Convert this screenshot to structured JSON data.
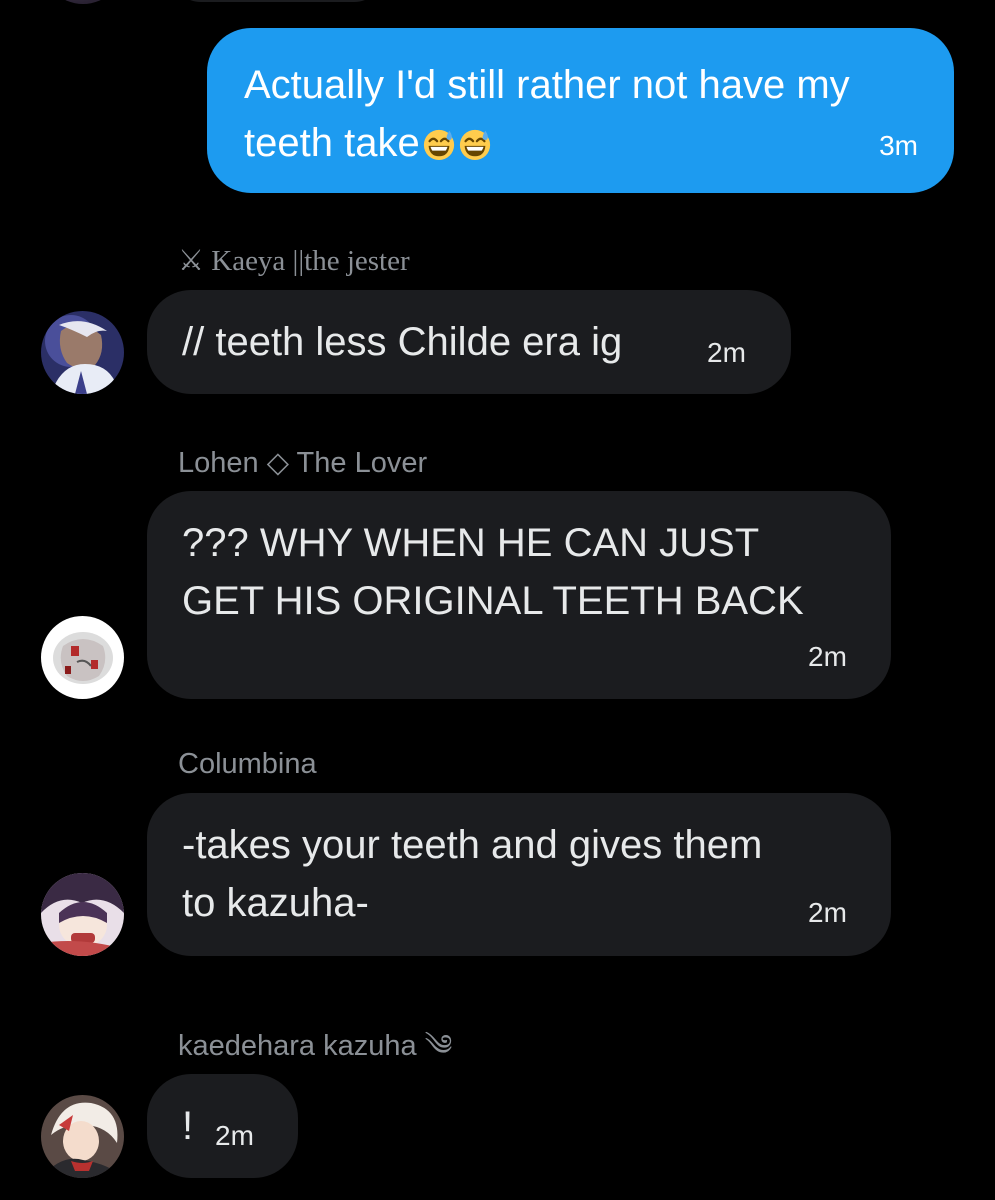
{
  "outgoing": {
    "text": "Actually I'd still rather not have my teeth take",
    "emoji": [
      "sweat-smile-emoji",
      "sweat-smile-emoji"
    ],
    "time": "3m",
    "bubble_color": "#1d9bf0"
  },
  "messages": [
    {
      "sender": "⚔ Kaeya ||the jester",
      "text": "// teeth less Childe era ig",
      "time": "2m",
      "avatar": "kaeya-avatar"
    },
    {
      "sender": "Lohen ◇ The Lover",
      "text_lines": [
        "??? WHY WHEN HE CAN JUST",
        "GET HIS ORIGINAL TEETH BACK"
      ],
      "time": "2m",
      "avatar": "lohen-avatar"
    },
    {
      "sender": "Columbina",
      "text_lines": [
        "-takes your teeth and gives them",
        "to kazuha-"
      ],
      "time": "2m",
      "avatar": "columbina-avatar"
    },
    {
      "sender": "kaedehara kazuha ༄",
      "text": "!",
      "time": "2m",
      "avatar": "kazuha-avatar"
    }
  ],
  "colors": {
    "background": "#000000",
    "incoming_bubble": "#1b1c1f",
    "sender_name": "#8b9096",
    "text": "#e7e9ea"
  }
}
